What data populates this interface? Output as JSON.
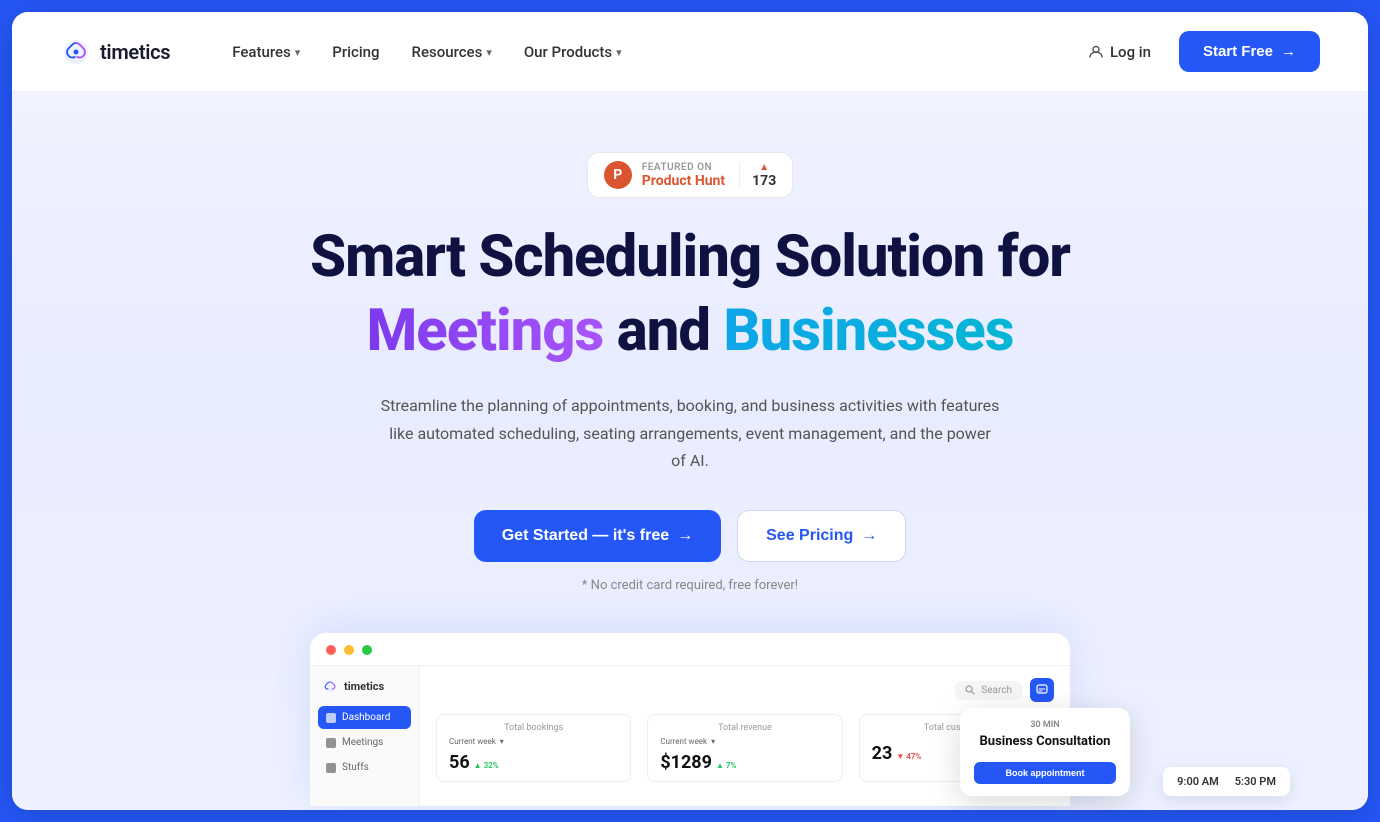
{
  "brand": {
    "name": "timetics",
    "logo_alt": "Timetics logo"
  },
  "navbar": {
    "features_label": "Features",
    "pricing_label": "Pricing",
    "resources_label": "Resources",
    "our_products_label": "Our Products",
    "login_label": "Log in",
    "start_free_label": "Start Free",
    "arrow": "→"
  },
  "product_hunt": {
    "featured_on": "FEATURED ON",
    "name": "Product Hunt",
    "votes": "173",
    "icon_letter": "P"
  },
  "hero": {
    "title_line1": "Smart Scheduling Solution for",
    "title_meetings": "Meetings",
    "title_and": " and ",
    "title_businesses": "Businesses",
    "subtitle": "Streamline the planning of appointments, booking, and business activities with features like automated scheduling, seating arrangements, event management, and the power of AI.",
    "cta_primary": "Get Started — it's free",
    "cta_secondary": "See Pricing",
    "arrow": "→",
    "note": "* No credit card required, free forever!"
  },
  "dashboard": {
    "sidebar": {
      "logo": "timetics",
      "nav_items": [
        {
          "label": "Dashboard",
          "active": true
        },
        {
          "label": "Meetings",
          "active": false
        },
        {
          "label": "Stuffs",
          "active": false
        }
      ]
    },
    "topbar": {
      "search_placeholder": "Search"
    },
    "stats": [
      {
        "label": "Total bookings",
        "week_label": "Current week",
        "value": "56",
        "change": "32%",
        "change_dir": "up"
      },
      {
        "label": "Total revenue",
        "week_label": "Current week",
        "value": "$1289",
        "change": "7%",
        "change_dir": "up"
      },
      {
        "label": "Total customers",
        "week_label": "",
        "value": "23",
        "change": "47%",
        "change_dir": "down"
      }
    ]
  },
  "consultation_card": {
    "duration": "30 MIN",
    "title": "Business Consultation",
    "book_btn": "Book appointment"
  },
  "time_card": {
    "start": "9:00 AM",
    "end": "5:30 PM"
  },
  "colors": {
    "primary": "#2557f7",
    "meetings_gradient_start": "#7c3aed",
    "meetings_gradient_end": "#a855f7",
    "businesses_gradient_start": "#0ea5e9",
    "businesses_gradient_end": "#06b6d4"
  }
}
